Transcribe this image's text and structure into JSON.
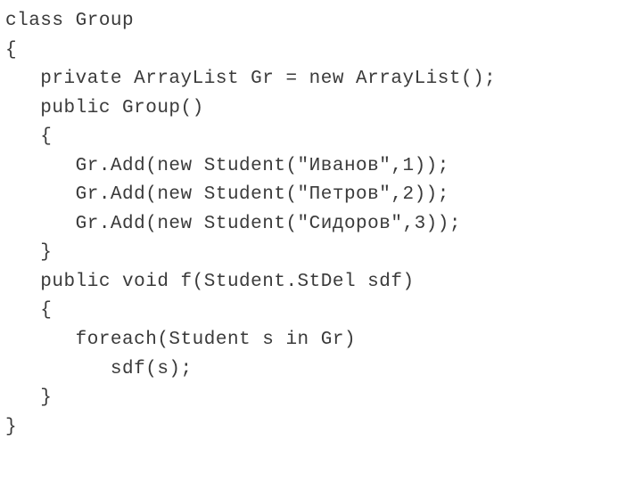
{
  "code": {
    "lines": [
      "class Group",
      "{",
      "   private ArrayList Gr = new ArrayList();",
      "   public Group()",
      "   {",
      "      Gr.Add(new Student(\"Иванов\",1));",
      "      Gr.Add(new Student(\"Петров\",2));",
      "      Gr.Add(new Student(\"Сидоров\",3));",
      "   }",
      "   public void f(Student.StDel sdf)",
      "   {",
      "      foreach(Student s in Gr)",
      "         sdf(s);",
      "   }",
      "}"
    ]
  }
}
